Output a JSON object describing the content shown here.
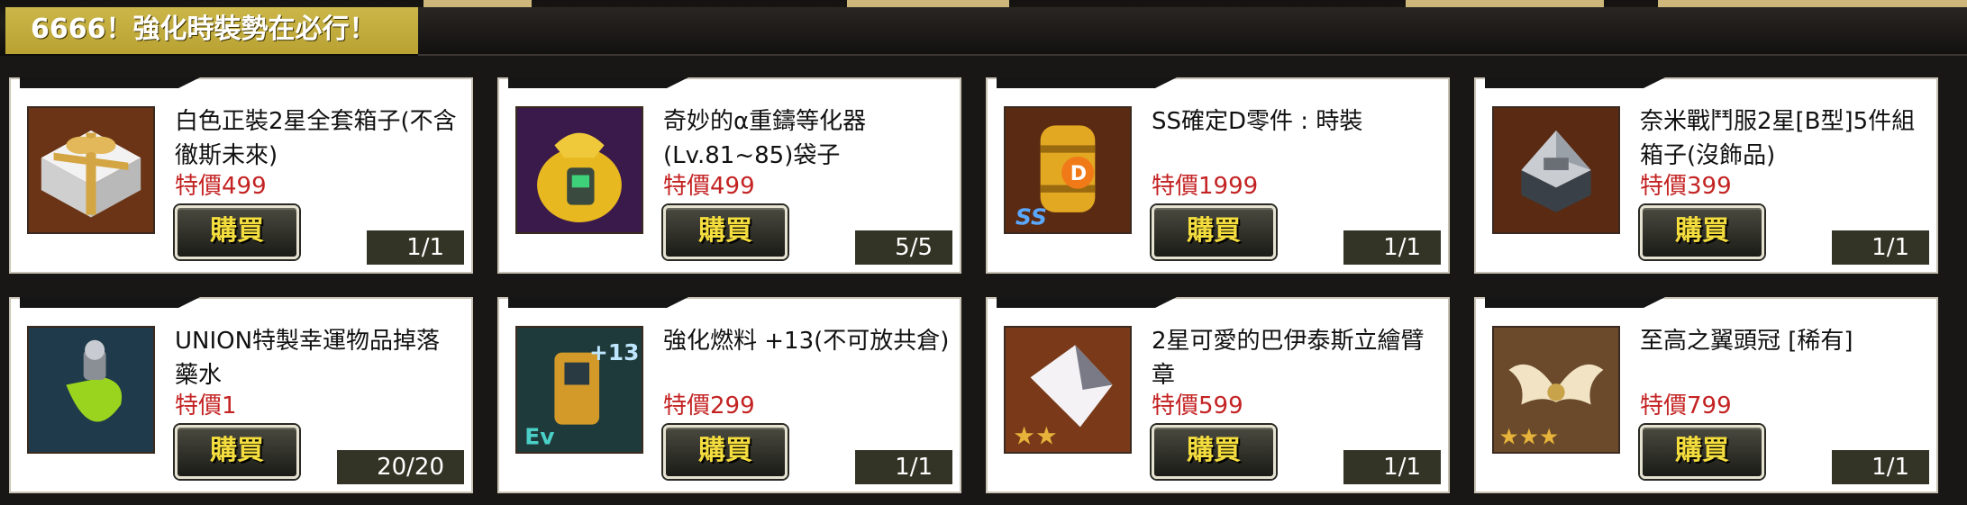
{
  "banner": {
    "title": "6666！強化時裝勢在必行！"
  },
  "buy_label": "購買",
  "colors": {
    "price": "#c42323",
    "banner": "#c1ab3c",
    "buy_text": "#f4dd3e"
  },
  "items": [
    {
      "name": "白色正裝2星全套箱子(不含徹斯未來)",
      "price": "特價499",
      "count": "1/1",
      "icon": "gift-box-icon"
    },
    {
      "name": "奇妙的α重鑄等化器(Lv.81~85)袋子",
      "price": "特價499",
      "count": "5/5",
      "icon": "gold-pouch-icon"
    },
    {
      "name": "SS確定D零件 : 時裝",
      "price": "特價1999",
      "count": "1/1",
      "icon": "ss-d-part-canister-icon"
    },
    {
      "name": "奈米戰鬥服2星[B型]5件組箱子(沒飾品)",
      "price": "特價399",
      "count": "1/1",
      "icon": "metal-crate-icon"
    },
    {
      "name": "UNION特製幸運物品掉落藥水",
      "price": "特價1",
      "count": "20/20",
      "icon": "green-potion-icon"
    },
    {
      "name": "強化燃料 +13(不可放共倉)",
      "price": "特價299",
      "count": "1/1",
      "icon": "fuel-can-icon"
    },
    {
      "name": "2星可愛的巴伊泰斯立繪臂章",
      "price": "特價599",
      "count": "1/1",
      "icon": "armband-icon"
    },
    {
      "name": "至高之翼頭冠 [稀有]",
      "price": "特價799",
      "count": "1/1",
      "icon": "wing-crown-icon"
    }
  ]
}
